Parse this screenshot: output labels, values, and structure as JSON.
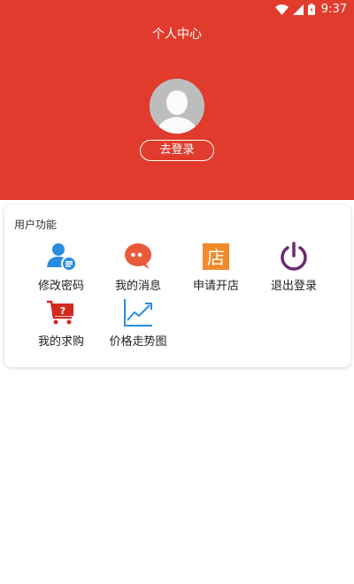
{
  "status_bar": {
    "time": "9:37",
    "icons": [
      "wifi-icon",
      "signal-icon",
      "battery-icon"
    ]
  },
  "header": {
    "title": "个人中心",
    "avatar_icon": "default-avatar-icon",
    "login_label": "去登录",
    "bg_color": "#e03b2c"
  },
  "user_functions": {
    "section_title": "用户功能",
    "items": [
      {
        "label": "修改密码",
        "icon": "user-edit-icon",
        "color": "#2b8de0"
      },
      {
        "label": "我的消息",
        "icon": "message-bubble-icon",
        "color": "#ea5a3a"
      },
      {
        "label": "申请开店",
        "icon": "shop-icon",
        "color": "#f08a2a"
      },
      {
        "label": "退出登录",
        "icon": "power-icon",
        "color": "#6b2a6e"
      },
      {
        "label": "我的求购",
        "icon": "shopping-cart-question-icon",
        "color": "#d32a20"
      },
      {
        "label": "价格走势图",
        "icon": "trend-chart-icon",
        "color": "#2b8de0"
      }
    ]
  }
}
